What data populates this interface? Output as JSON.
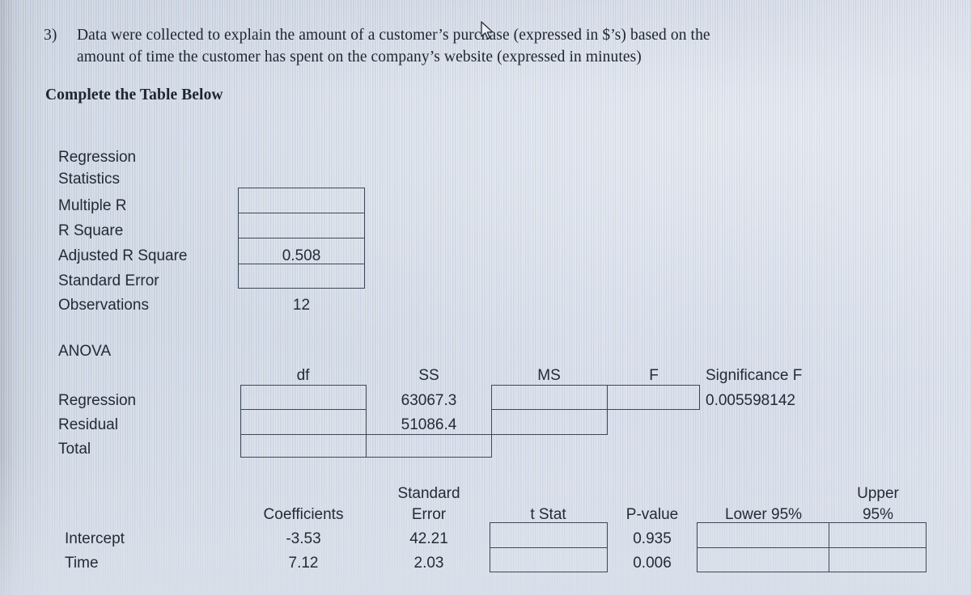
{
  "question": {
    "number": "3)",
    "line1": "Data were collected to explain the amount of a customer’s purchase (expressed in $’s) based on the",
    "line2": "amount of time the customer has spent on the company’s website (expressed in minutes)",
    "instruction": "Complete the Table Below"
  },
  "regression_statistics": {
    "title_line1": "Regression",
    "title_line2": "Statistics",
    "rows": [
      {
        "label": "Multiple R",
        "value": ""
      },
      {
        "label": "R Square",
        "value": ""
      },
      {
        "label": "Adjusted R Square",
        "value": "0.508"
      },
      {
        "label": "Standard Error",
        "value": ""
      },
      {
        "label": "Observations",
        "value": "12"
      }
    ]
  },
  "anova": {
    "title": "ANOVA",
    "headers": {
      "df": "df",
      "ss": "SS",
      "ms": "MS",
      "f": "F",
      "significance_f": "Significance F"
    },
    "rows": [
      {
        "label": "Regression",
        "df": "",
        "ss": "63067.3",
        "ms": "",
        "f": "",
        "significance_f": "0.005598142"
      },
      {
        "label": "Residual",
        "df": "",
        "ss": "51086.4",
        "ms": "",
        "f": "",
        "significance_f": ""
      },
      {
        "label": "Total",
        "df": "",
        "ss": "",
        "ms": "",
        "f": "",
        "significance_f": ""
      }
    ]
  },
  "coefficients_table": {
    "headers": {
      "coefficients": "Coefficients",
      "standard_error_line1": "Standard",
      "standard_error_line2": "Error",
      "t_stat": "t Stat",
      "p_value": "P-value",
      "lower95": "Lower 95%",
      "upper95_line1": "Upper",
      "upper95_line2": "95%"
    },
    "rows": [
      {
        "label": "Intercept",
        "coefficients": "-3.53",
        "standard_error": "42.21",
        "t_stat": "",
        "p_value": "0.935",
        "lower95": "",
        "upper95": ""
      },
      {
        "label": "Time",
        "coefficients": "7.12",
        "standard_error": "2.03",
        "t_stat": "",
        "p_value": "0.006",
        "lower95": "",
        "upper95": ""
      }
    ]
  },
  "colors": {
    "paper": "#ccd6e3",
    "ink": "#232b36",
    "rule": "#3c4756"
  },
  "pointer": {
    "icon": "mouse-cursor-icon"
  }
}
